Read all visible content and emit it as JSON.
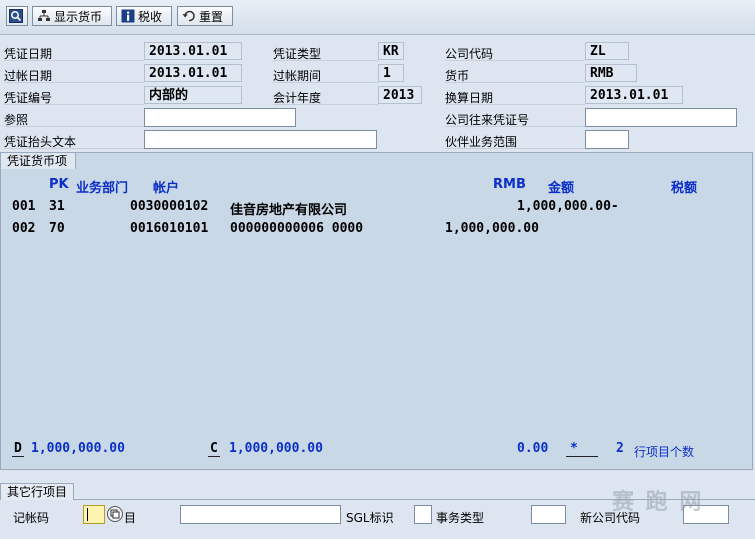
{
  "toolbar": {
    "display_currency_label": "显示货币",
    "tax_label": "税收",
    "reset_label": "重置"
  },
  "header": {
    "doc_date_label": "凭证日期",
    "doc_date": "2013.01.01",
    "doc_type_label": "凭证类型",
    "doc_type": "KR",
    "company_code_label": "公司代码",
    "company_code": "ZL",
    "posting_date_label": "过帐日期",
    "posting_date": "2013.01.01",
    "period_label": "过帐期间",
    "period": "1",
    "currency_label": "货币",
    "currency": "RMB",
    "doc_number_label": "凭证编号",
    "doc_number": "内部的",
    "fiscal_year_label": "会计年度",
    "fiscal_year": "2013",
    "translation_date_label": "换算日期",
    "translation_date": "2013.01.01",
    "reference_label": "参照",
    "intercompany_label": "公司往来凭证号",
    "header_text_label": "凭证抬头文本",
    "partner_ba_label": "伙伴业务范围"
  },
  "items_panel": {
    "title": "凭证货币项",
    "columns": {
      "pk": "PK",
      "business_area": "业务部门",
      "account": "帐户",
      "currency": "RMB",
      "amount": "金额",
      "tax": "税额"
    },
    "rows": [
      {
        "no": "001",
        "pk": "31",
        "account": "0030000102",
        "name": "佳音房地产有限公司",
        "amount": "1,000,000.00-"
      },
      {
        "no": "002",
        "pk": "70",
        "account": "0016010101",
        "name": "000000000006 0000",
        "amount": "1,000,000.00"
      }
    ],
    "footer": {
      "debit_label": "D",
      "debit_amount": "1,000,000.00",
      "credit_label": "C",
      "credit_amount": "1,000,000.00",
      "balance": "0.00",
      "star": "*",
      "item_count": "2",
      "item_count_label": "行项目个数"
    }
  },
  "other_item": {
    "title": "其它行项目",
    "posting_key_label": "记帐码",
    "account_label": "目",
    "sgl_label": "SGL标识",
    "transaction_type_label": "事务类型",
    "new_company_label": "新公司代码"
  },
  "watermark": "赛 跑 网",
  "colors": {
    "accent_blue": "#0b2fc8",
    "panel_bg": "#c9d8e6",
    "page_bg": "#dde6f0",
    "focus_field": "#fff3b0"
  }
}
